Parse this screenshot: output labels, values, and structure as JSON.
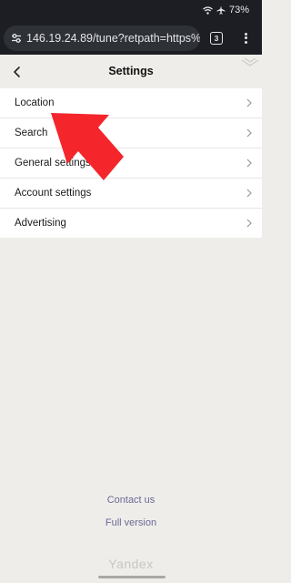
{
  "status_bar": {
    "battery": "73%"
  },
  "browser": {
    "url": "146.19.24.89/tune?retpath=https%",
    "tab_count": "3"
  },
  "header": {
    "title": "Settings"
  },
  "settings": {
    "items": [
      {
        "label": "Location"
      },
      {
        "label": "Search"
      },
      {
        "label": "General settings"
      },
      {
        "label": "Account settings"
      },
      {
        "label": "Advertising"
      }
    ]
  },
  "footer": {
    "contact": "Contact us",
    "full_version": "Full version",
    "brand": "Yandex"
  },
  "colors": {
    "page_bg": "#efedea",
    "link": "#6b6a96",
    "annotation_arrow": "#f4262b"
  }
}
